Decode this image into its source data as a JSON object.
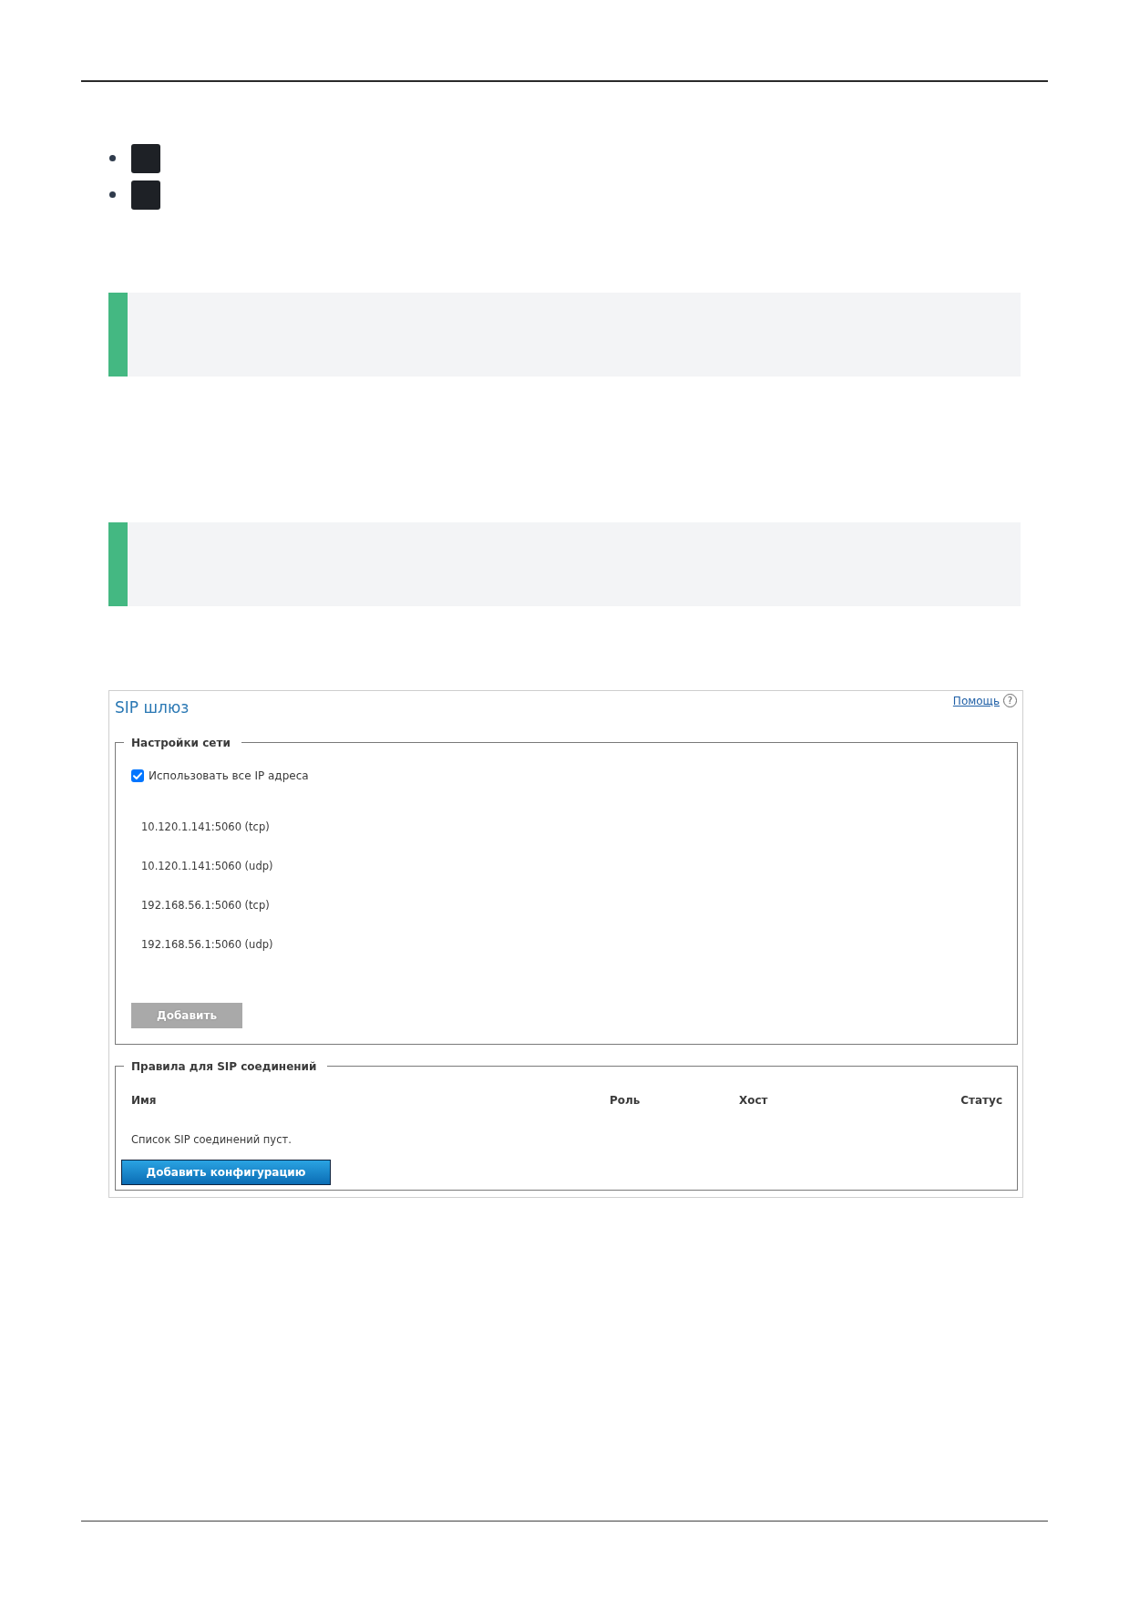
{
  "bullet_list": [
    {
      "kind": "redacted"
    },
    {
      "kind": "redacted"
    }
  ],
  "callouts": [
    {
      "kind": "note"
    },
    {
      "kind": "note"
    }
  ],
  "sip_gateway": {
    "title": "SIP шлюз",
    "help_link": "Помощь",
    "help_icon": "?",
    "network_settings": {
      "legend": "Настройки сети",
      "use_all_ip": {
        "label": "Использовать все IP адреса",
        "checked": true
      },
      "addresses": [
        "10.120.1.141:5060 (tcp)",
        "10.120.1.141:5060 (udp)",
        "192.168.56.1:5060 (tcp)",
        "192.168.56.1:5060 (udp)"
      ],
      "add_button": {
        "label": "Добавить",
        "disabled": true
      }
    },
    "sip_rules": {
      "legend": "Правила для SIP соединений",
      "columns": [
        "Имя",
        "Роль",
        "Хост",
        "Статус"
      ],
      "empty_message": "Список SIP соединений пуст.",
      "add_button": {
        "label": "Добавить конфигурацию",
        "disabled": false
      }
    }
  }
}
